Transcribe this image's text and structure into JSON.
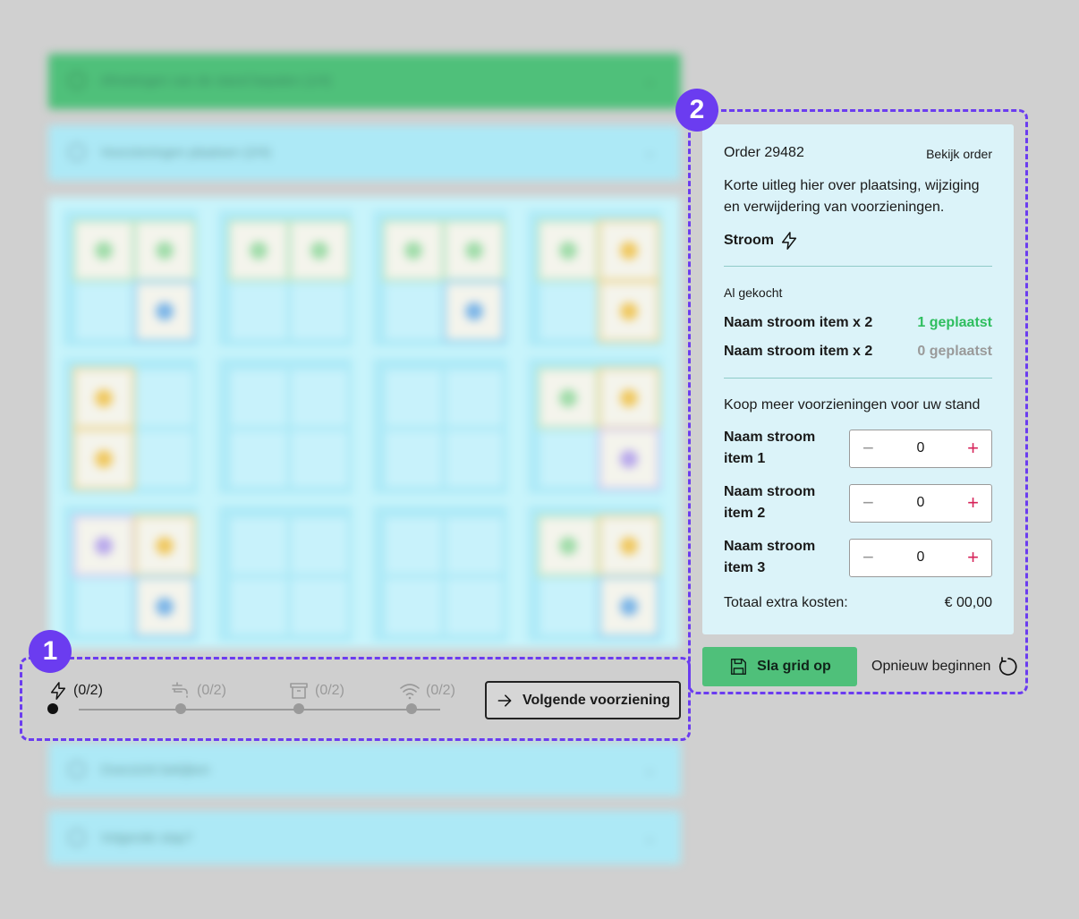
{
  "background": {
    "accordion": [
      "Afmetingen van de stand bepalen (1/4)",
      "Voorzieningen plaatsen (2/4)",
      "Overzicht bekijken",
      "Volgende stap?"
    ]
  },
  "badges": {
    "one": "1",
    "two": "2"
  },
  "stepper": {
    "steps": [
      {
        "icon": "lightning-icon",
        "count": "(0/2)",
        "active": true
      },
      {
        "icon": "water-tap-icon",
        "count": "(0/2)",
        "active": false
      },
      {
        "icon": "archive-box-icon",
        "count": "(0/2)",
        "active": false
      },
      {
        "icon": "wifi-icon",
        "count": "(0/2)",
        "active": false
      }
    ],
    "next_label": "Volgende voorziening"
  },
  "panel": {
    "order_title": "Order 29482",
    "view_order": "Bekijk order",
    "intro": "Korte uitleg hier over plaatsing, wijziging en verwijdering van voorzieningen.",
    "category": "Stroom",
    "bought_heading": "Al gekocht",
    "bought": [
      {
        "name": "Naam stroom item x 2",
        "status": "1 geplaatst",
        "color": "#2fbe5f"
      },
      {
        "name": "Naam stroom item x 2",
        "status": "0 geplaatst",
        "color": "#9a9a9a"
      }
    ],
    "buy_heading": "Koop meer voorzieningen voor uw stand",
    "buy_items": [
      {
        "name": "Naam stroom item 1",
        "qty": "0"
      },
      {
        "name": "Naam stroom item 2",
        "qty": "0"
      },
      {
        "name": "Naam stroom item 3",
        "qty": "0"
      }
    ],
    "total_label": "Totaal extra kosten:",
    "total_value": "€ 00,00"
  },
  "actions": {
    "save_label": "Sla grid op",
    "restart_label": "Opnieuw beginnen"
  },
  "colors": {
    "accent": "#6b3cf0",
    "save": "#4fc07a",
    "plus": "#d6245a"
  }
}
